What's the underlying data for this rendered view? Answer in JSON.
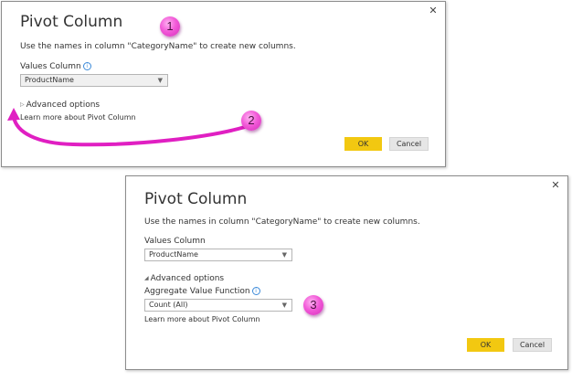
{
  "dialog1": {
    "title": "Pivot Column",
    "description": "Use the names in column \"CategoryName\" to create new columns.",
    "values_column_label": "Values Column",
    "values_column_value": "ProductName",
    "advanced_options_label": "Advanced options",
    "learn_more_link": "Learn more about Pivot Column",
    "ok_label": "OK",
    "cancel_label": "Cancel"
  },
  "dialog2": {
    "title": "Pivot Column",
    "description": "Use the names in column \"CategoryName\" to create new columns.",
    "values_column_label": "Values Column",
    "values_column_value": "ProductName",
    "advanced_options_label": "Advanced options",
    "aggregate_label": "Aggregate Value Function",
    "aggregate_value": "Count (All)",
    "learn_more_link": "Learn more about Pivot Column",
    "ok_label": "OK",
    "cancel_label": "Cancel"
  },
  "callouts": [
    "1",
    "2",
    "3"
  ],
  "icons": {
    "close": "close-icon",
    "info": "info-icon",
    "dropdown": "chevron-down-icon",
    "collapsed": "triangle-right-icon",
    "expanded": "triangle-down-icon"
  },
  "colors": {
    "ok_button": "#f2c811",
    "callout": "#f25ad8",
    "arrow": "#e01fc2",
    "info": "#3b8ad9"
  }
}
